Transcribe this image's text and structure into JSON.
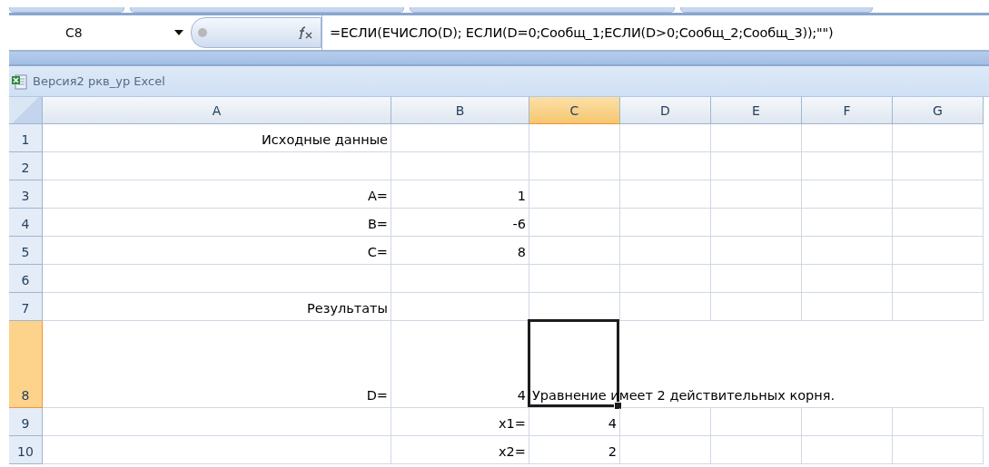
{
  "name_box": {
    "value": "C8"
  },
  "formula_bar": {
    "value": "=ЕСЛИ(ЕЧИСЛО(D); ЕСЛИ(D=0;Сообщ_1;ЕСЛИ(D>0;Сообщ_2;Сообщ_3));\"\")"
  },
  "workbook": {
    "title": "Версия2 ркв_ур Excel"
  },
  "columns": [
    {
      "label": "A",
      "selected": false
    },
    {
      "label": "B",
      "selected": false
    },
    {
      "label": "C",
      "selected": true
    },
    {
      "label": "D",
      "selected": false
    },
    {
      "label": "E",
      "selected": false
    },
    {
      "label": "F",
      "selected": false
    },
    {
      "label": "G",
      "selected": false
    }
  ],
  "rows": [
    {
      "number": "1",
      "selected": false,
      "tall": false,
      "cells": {
        "A": {
          "text": "Исходные данные",
          "kind": "value",
          "selected": false
        }
      }
    },
    {
      "number": "2",
      "selected": false,
      "tall": false,
      "cells": {}
    },
    {
      "number": "3",
      "selected": false,
      "tall": false,
      "cells": {
        "A": {
          "text": "А=",
          "kind": "value",
          "selected": false
        },
        "B": {
          "text": "1",
          "kind": "value",
          "selected": false
        }
      }
    },
    {
      "number": "4",
      "selected": false,
      "tall": false,
      "cells": {
        "A": {
          "text": "В=",
          "kind": "value",
          "selected": false
        },
        "B": {
          "text": "-6",
          "kind": "value",
          "selected": false
        }
      }
    },
    {
      "number": "5",
      "selected": false,
      "tall": false,
      "cells": {
        "A": {
          "text": "С=",
          "kind": "value",
          "selected": false
        },
        "B": {
          "text": "8",
          "kind": "value",
          "selected": false
        }
      }
    },
    {
      "number": "6",
      "selected": false,
      "tall": false,
      "cells": {}
    },
    {
      "number": "7",
      "selected": false,
      "tall": false,
      "cells": {
        "A": {
          "text": "Результаты",
          "kind": "value",
          "selected": false
        }
      }
    },
    {
      "number": "8",
      "selected": true,
      "tall": true,
      "cells": {
        "A": {
          "text": "D=",
          "kind": "value",
          "selected": false
        },
        "B": {
          "text": "4",
          "kind": "value",
          "selected": false
        },
        "C": {
          "text": "Уравнение имеет 2 действительных корня.",
          "kind": "message",
          "selected": true
        }
      }
    },
    {
      "number": "9",
      "selected": false,
      "tall": false,
      "cells": {
        "B": {
          "text": "x1=",
          "kind": "value",
          "selected": false
        },
        "C": {
          "text": "4",
          "kind": "value",
          "selected": false
        }
      }
    },
    {
      "number": "10",
      "selected": false,
      "tall": false,
      "cells": {
        "B": {
          "text": "x2=",
          "kind": "value",
          "selected": false
        },
        "C": {
          "text": "2",
          "kind": "value",
          "selected": false
        }
      }
    }
  ]
}
